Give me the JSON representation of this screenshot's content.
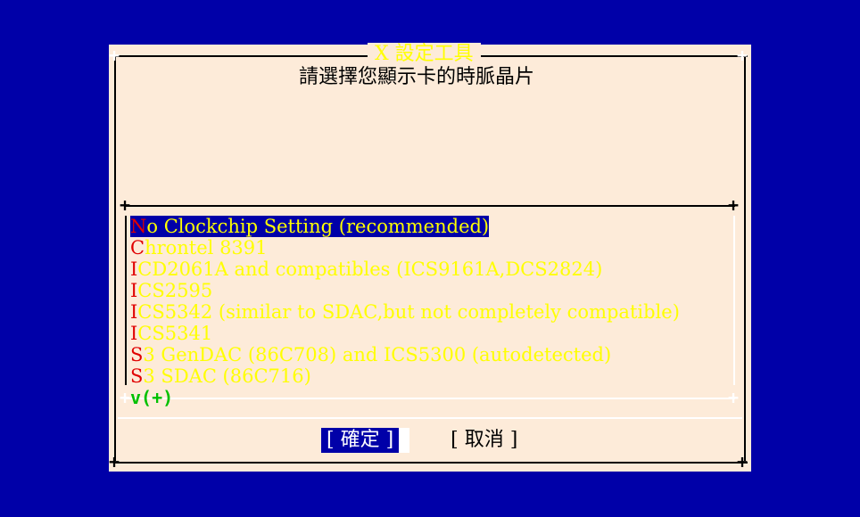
{
  "dialog": {
    "title": "X 設定工具",
    "prompt": "請選擇您顯示卡的時脈晶片"
  },
  "list": {
    "items": [
      {
        "hotkey": "N",
        "label": "o Clockchip Setting (recommended)",
        "selected": true
      },
      {
        "hotkey": "C",
        "label": "hrontel 8391",
        "selected": false
      },
      {
        "hotkey": "I",
        "label": "CD2061A and compatibles (ICS9161A,DCS2824)",
        "selected": false
      },
      {
        "hotkey": "I",
        "label": "CS2595",
        "selected": false
      },
      {
        "hotkey": "I",
        "label": "CS5342 (similar to SDAC,but not completely compatible)",
        "selected": false
      },
      {
        "hotkey": "I",
        "label": "CS5341",
        "selected": false
      },
      {
        "hotkey": "S",
        "label": "3 GenDAC (86C708) and ICS5300 (autodetected)",
        "selected": false
      },
      {
        "hotkey": "S",
        "label": "3 SDAC (86C716)",
        "selected": false
      }
    ],
    "scroll_indicator": "v(+)"
  },
  "buttons": {
    "ok_label": "[ 確定 ]",
    "cancel_label": "[ 取消 ]"
  },
  "colors": {
    "screen_background": "#0000a8",
    "dialog_background": "#fdebd9",
    "item_text": "#ffff00",
    "hotkey": "#e00000",
    "selection_background": "#0000a8",
    "scroll_indicator": "#00c000"
  }
}
